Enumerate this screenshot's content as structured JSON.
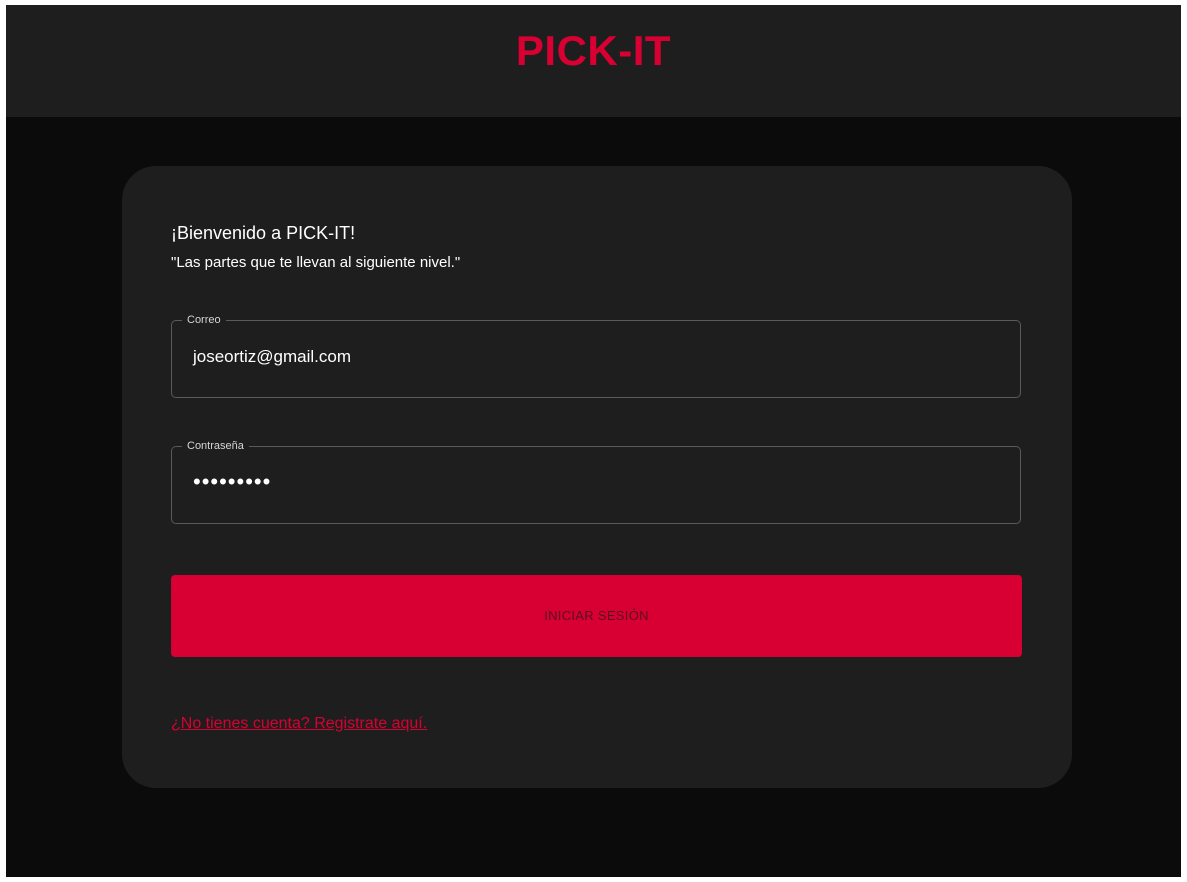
{
  "header": {
    "brand": "PICK-IT"
  },
  "login": {
    "welcome": "¡Bienvenido a PICK-IT!",
    "tagline": "\"Las partes que te llevan al siguiente nivel.\"",
    "email": {
      "label": "Correo",
      "value": "joseortiz@gmail.com"
    },
    "password": {
      "label": "Contraseña",
      "value": "•••••••••"
    },
    "submit_label": "INICIAR SESIÓN",
    "register_link": "¿No tienes cuenta? Registrate aquí."
  },
  "colors": {
    "accent": "#d80032",
    "background": "#0b0b0b",
    "surface": "#1e1e1e"
  }
}
